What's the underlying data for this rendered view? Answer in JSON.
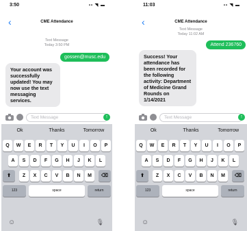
{
  "left": {
    "time": "3:50",
    "status_icons": "▪▪ ◥ ▬",
    "contact": "CME Attendance",
    "meta_line1": "Text Message",
    "meta_line2": "Today 3:50 PM",
    "outgoing": "gossen@musc.edu",
    "incoming": "Your account was successfully updated! You may now use the text messaging services.",
    "placeholder": "Text Message"
  },
  "right": {
    "time": "11:03",
    "status_icons": "▪▪ ◥ ▬",
    "contact": "CME Attendance",
    "meta_line1": "Text Message",
    "meta_line2": "Today 11:02 AM",
    "outgoing": "Attend 236760",
    "incoming": "Success! Your attendance has been recorded for the following activity: Department of Medicine Grand Rounds on 1/14/2021",
    "placeholder": "Text Message"
  },
  "keyboard": {
    "suggestions": [
      "Ok",
      "Thanks",
      "Tomorrow"
    ],
    "row1": [
      "Q",
      "W",
      "E",
      "R",
      "T",
      "Y",
      "U",
      "I",
      "O",
      "P"
    ],
    "row2": [
      "A",
      "S",
      "D",
      "F",
      "G",
      "H",
      "J",
      "K",
      "L"
    ],
    "row3": [
      "Z",
      "X",
      "C",
      "V",
      "B",
      "N",
      "M"
    ],
    "numbers_key": "123",
    "space_key": "space",
    "return_key": "return"
  },
  "colors": {
    "accent": "#1a7bf5",
    "sent_bubble": "#1ebe5a",
    "received_bubble": "#e9e9eb",
    "keyboard_bg": "#d3d5da"
  },
  "icons": [
    "back-chevron-icon",
    "camera-icon",
    "apps-icon",
    "send-arrow-icon",
    "shift-icon",
    "backspace-icon",
    "emoji-icon",
    "microphone-icon"
  ]
}
